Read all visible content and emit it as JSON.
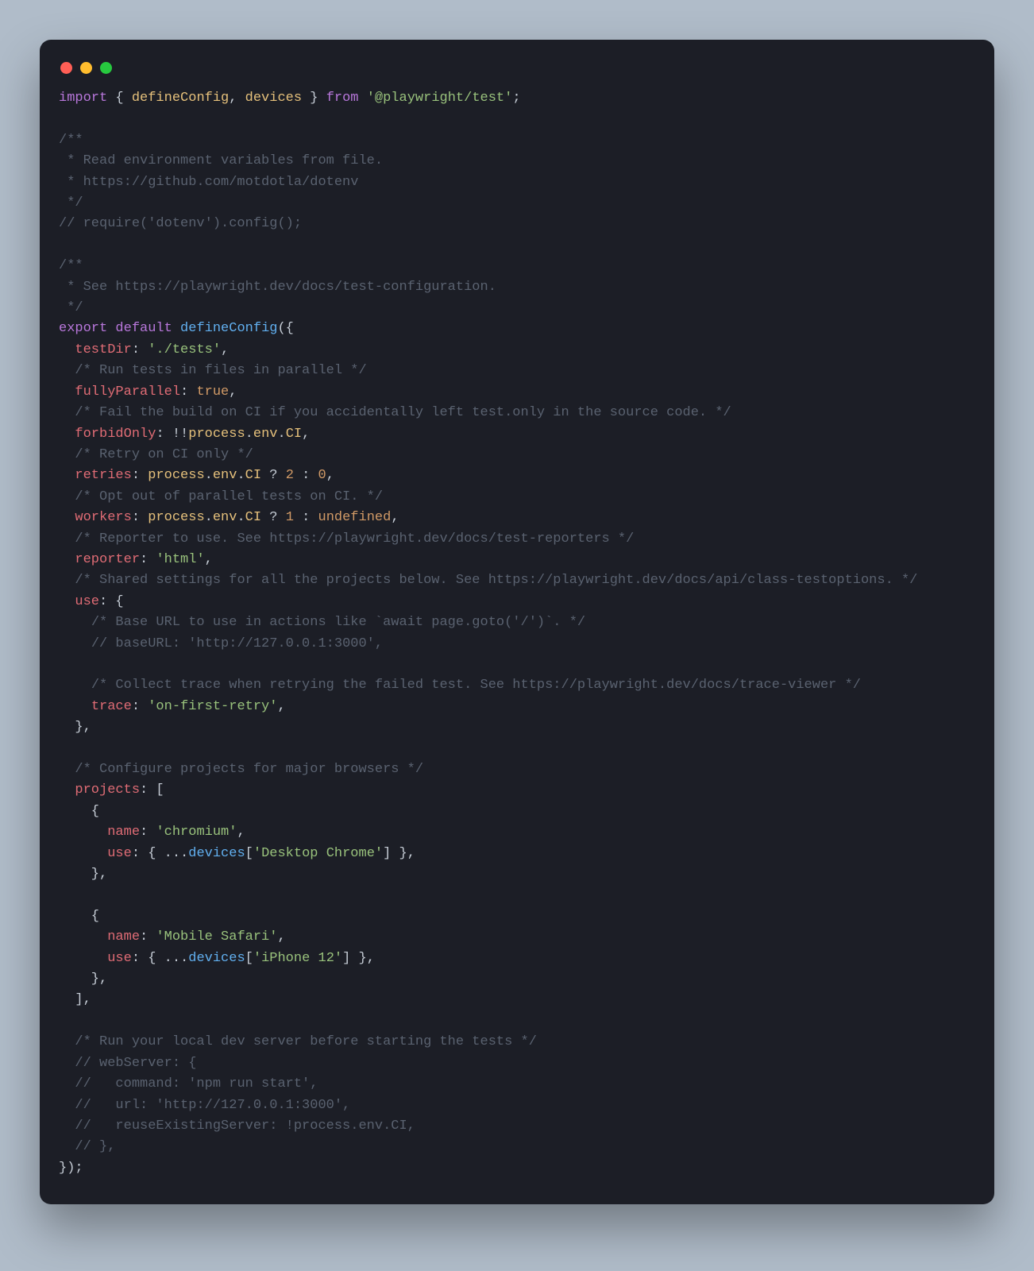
{
  "window": {
    "controls": {
      "close": "close",
      "min": "minimize",
      "max": "maximize"
    }
  },
  "code": {
    "t_import": "import",
    "t_from": "from",
    "t_export": "export",
    "t_default": "default",
    "t_true": "true",
    "t_undefined": "undefined",
    "i_defineConfig": "defineConfig",
    "i_devices": "devices",
    "i_process": "process",
    "i_env": "env",
    "i_CI": "CI",
    "s_pkg": "'@playwright/test'",
    "s_testsDir": "'./tests'",
    "s_html": "'html'",
    "s_onFirstRetry": "'on-first-retry'",
    "s_chromium": "'chromium'",
    "s_desktopChrome": "'Desktop Chrome'",
    "s_mobileSafari": "'Mobile Safari'",
    "s_iphone12": "'iPhone 12'",
    "n_2": "2",
    "n_0": "0",
    "n_1": "1",
    "p_testDir": "testDir",
    "p_fullyParallel": "fullyParallel",
    "p_forbidOnly": "forbidOnly",
    "p_retries": "retries",
    "p_workers": "workers",
    "p_reporter": "reporter",
    "p_use": "use",
    "p_trace": "trace",
    "p_projects": "projects",
    "p_name": "name",
    "cm1": "/**",
    "cm2": " * Read environment variables from file.",
    "cm3": " * https://github.com/motdotla/dotenv",
    "cm4": " */",
    "cm5": "// require('dotenv').config();",
    "cm6": "/**",
    "cm7": " * See https://playwright.dev/docs/test-configuration.",
    "cm8": " */",
    "cm9": "/* Run tests in files in parallel */",
    "cm10": "/* Fail the build on CI if you accidentally left test.only in the source code. */",
    "cm11": "/* Retry on CI only */",
    "cm12": "/* Opt out of parallel tests on CI. */",
    "cm13": "/* Reporter to use. See https://playwright.dev/docs/test-reporters */",
    "cm14": "/* Shared settings for all the projects below. See https://playwright.dev/docs/api/class-testoptions. */",
    "cm15": "/* Base URL to use in actions like `await page.goto('/')`. */",
    "cm16": "// baseURL: 'http://127.0.0.1:3000',",
    "cm17": "/* Collect trace when retrying the failed test. See https://playwright.dev/docs/trace-viewer */",
    "cm18": "/* Configure projects for major browsers */",
    "cm19": "/* Run your local dev server before starting the tests */",
    "cm20": "// webServer: {",
    "cm21": "//   command: 'npm run start',",
    "cm22": "//   url: 'http://127.0.0.1:3000',",
    "cm23": "//   reuseExistingServer: !process.env.CI,",
    "cm24": "// },"
  }
}
